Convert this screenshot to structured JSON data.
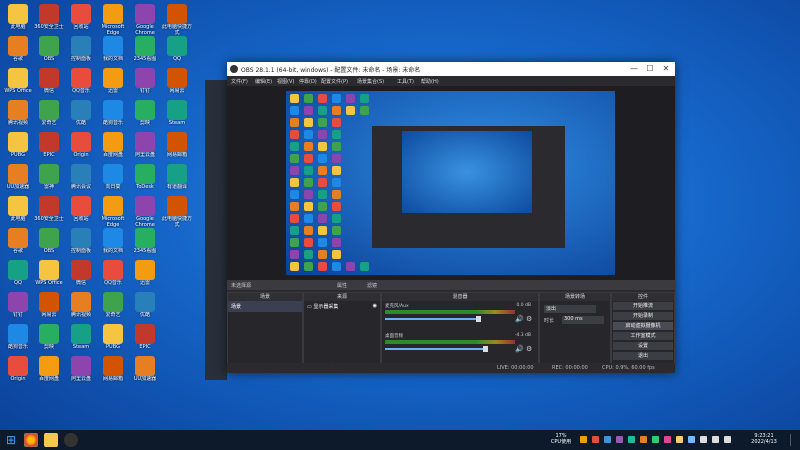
{
  "window": {
    "title": "OBS 28.1.1 (64-bit, windows) - 配置文件: 未命名 - 场景: 未命名",
    "menu": [
      "文件(F)",
      "编辑(E)",
      "视图(V)",
      "停靠(D)",
      "配置文件(P)",
      "场景集合(S)",
      "工具(T)",
      "帮助(H)"
    ],
    "controls": {
      "minimize": "—",
      "maximize": "☐",
      "close": "✕"
    }
  },
  "preview": {
    "source_label": "未选择源",
    "tab_props": "属性",
    "tab_filters": "滤镜"
  },
  "docks": {
    "scenes": {
      "title": "场景",
      "items": [
        "场景"
      ]
    },
    "sources": {
      "title": "来源",
      "items": [
        "显示器采集"
      ]
    },
    "mixer": {
      "title": "混音器",
      "channels": [
        {
          "name": "麦克风/Aux",
          "db": "0.0 dB",
          "level": 0.72
        },
        {
          "name": "桌面音频",
          "db": "-4.3 dB",
          "level": 0.78
        }
      ]
    },
    "transitions": {
      "title": "场景转场",
      "type": "淡出",
      "duration_label": "时长",
      "duration": "300 ms"
    },
    "controls": {
      "title": "控件",
      "buttons": [
        "开始推流",
        "开始录制",
        "启动虚拟摄像机",
        "工作室模式",
        "设置",
        "退出"
      ]
    }
  },
  "statusbar": {
    "live": "LIVE: 00:00:00",
    "rec": "REC: 00:00:00",
    "cpu": "CPU: 0.9%, 60.00 fps"
  },
  "taskbar": {
    "cpu_pct": "17%",
    "cpu_label": "CPU使用",
    "time": "9:23:21",
    "date": "2022/4/13"
  },
  "desktop_icons": [
    "此电脑",
    "360安全卫士",
    "回收站",
    "Microsoft Edge",
    "Google Chrome",
    "此电脑快捷方式",
    "谷歌",
    "OBS",
    "控制面板",
    "我的文档",
    "2345看图",
    "QQ",
    "WPS Office",
    "微信",
    "QQ音乐",
    "迅雷",
    "钉钉",
    "网易云",
    "腾讯视频",
    "爱奇艺",
    "优酷",
    "酷狗音乐",
    "剪映",
    "Steam",
    "PUBG",
    "EPIC",
    "Origin",
    "百度网盘",
    "阿里云盘",
    "网易邮箱",
    "UU加速器",
    "雷神",
    "腾讯会议",
    "向日葵",
    "ToDesk",
    "有道翻译"
  ],
  "colors": {
    "accent": "#1e6fd1",
    "obs_bg": "#2a2a2f",
    "desktop": "#1565c8"
  }
}
